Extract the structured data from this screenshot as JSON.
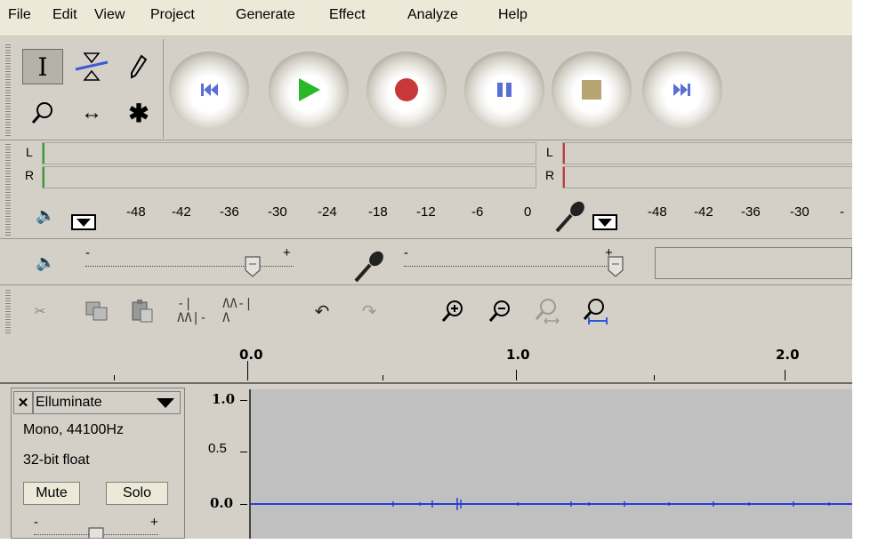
{
  "menu": [
    "File",
    "Edit",
    "View",
    "Project",
    "Generate",
    "Effect",
    "Analyze",
    "Help"
  ],
  "tools": [
    {
      "name": "selection-tool",
      "glyph": "I"
    },
    {
      "name": "envelope-tool",
      "glyph": "envelope-icon"
    },
    {
      "name": "draw-tool",
      "glyph": "pencil-icon"
    },
    {
      "name": "zoom-tool",
      "glyph": "magnifier-icon"
    },
    {
      "name": "timeshift-tool",
      "glyph": "↔"
    },
    {
      "name": "multi-tool",
      "glyph": "✱"
    }
  ],
  "transport": [
    {
      "name": "skip-to-start-button",
      "icon": "skip-start-icon",
      "color": "#5a6fd6"
    },
    {
      "name": "play-button",
      "icon": "play-icon",
      "color": "#28b828"
    },
    {
      "name": "record-button",
      "icon": "record-icon",
      "color": "#c83838"
    },
    {
      "name": "pause-button",
      "icon": "pause-icon",
      "color": "#5a6fd6"
    },
    {
      "name": "stop-button",
      "icon": "stop-icon",
      "color": "#b8a470"
    },
    {
      "name": "skip-to-end-button",
      "icon": "skip-end-icon",
      "color": "#5a6fd6"
    }
  ],
  "meters": {
    "playback": {
      "left_label": "L",
      "right_label": "R",
      "ticks": [
        "-48",
        "-42",
        "-36",
        "-30",
        "-24",
        "-18",
        "-12",
        "-6",
        "0"
      ]
    },
    "record": {
      "left_label": "L",
      "right_label": "R",
      "ticks": [
        "-48",
        "-42",
        "-36",
        "-30",
        "-"
      ]
    }
  },
  "mixer": {
    "volume_minus": "-",
    "volume_plus": "+",
    "input_minus": "-",
    "input_plus": "+"
  },
  "ruler": {
    "labels": [
      "0.0",
      "1.0",
      "2.0"
    ]
  },
  "track": {
    "close_glyph": "✕",
    "name": "Elluminate",
    "info_line1": "Mono, 44100Hz",
    "info_line2": "32-bit float",
    "mute_label": "Mute",
    "solo_label": "Solo",
    "gain_minus": "-",
    "gain_plus": "+",
    "vertical_scale": [
      "1.0",
      "0.5",
      "0.0"
    ]
  },
  "colors": {
    "waveform": "#2a3cd8",
    "record_meter_mark": "#c83838",
    "play_meter_mark": "#30a030"
  }
}
